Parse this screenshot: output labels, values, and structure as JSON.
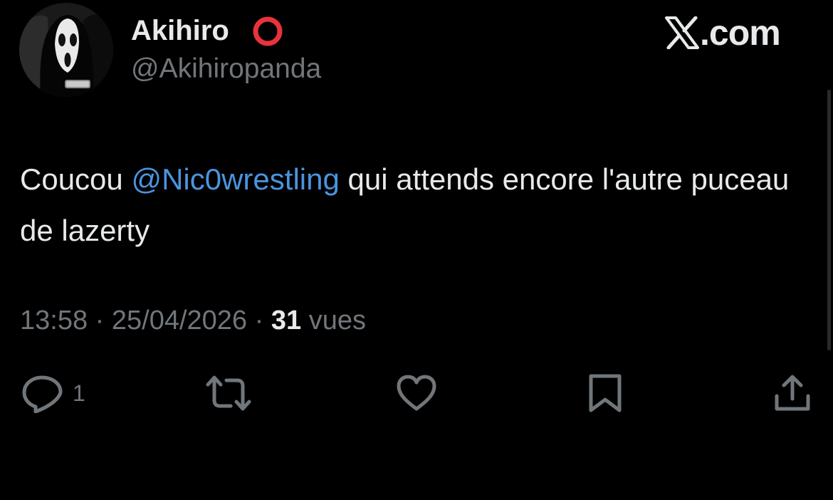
{
  "tweet": {
    "author": {
      "display_name": "Akihiro",
      "handle": "@Akihiropanda",
      "avatar_icon": "ghostface-avatar",
      "badge_icon": "red-circle-emoji",
      "badge_color": "#e8333a"
    },
    "site": {
      "logo_icon": "x-logo-icon",
      "suffix": ".com"
    },
    "text": {
      "prefix": "Coucou ",
      "mention": "@Nic0wrestling",
      "suffix": " qui attends encore l'autre puceau de lazerty"
    },
    "meta": {
      "time": "13:58",
      "separator": "·",
      "date": "25/04/2026",
      "views_count": "31",
      "views_label": "vues"
    },
    "actions": {
      "reply_count": "1",
      "reply_icon": "reply-icon",
      "retweet_icon": "retweet-icon",
      "like_icon": "heart-icon",
      "bookmark_icon": "bookmark-icon",
      "share_icon": "share-icon"
    }
  },
  "colors": {
    "background": "#000000",
    "text_primary": "#e7e9ea",
    "text_secondary": "#71767b",
    "mention": "#4a94de"
  }
}
